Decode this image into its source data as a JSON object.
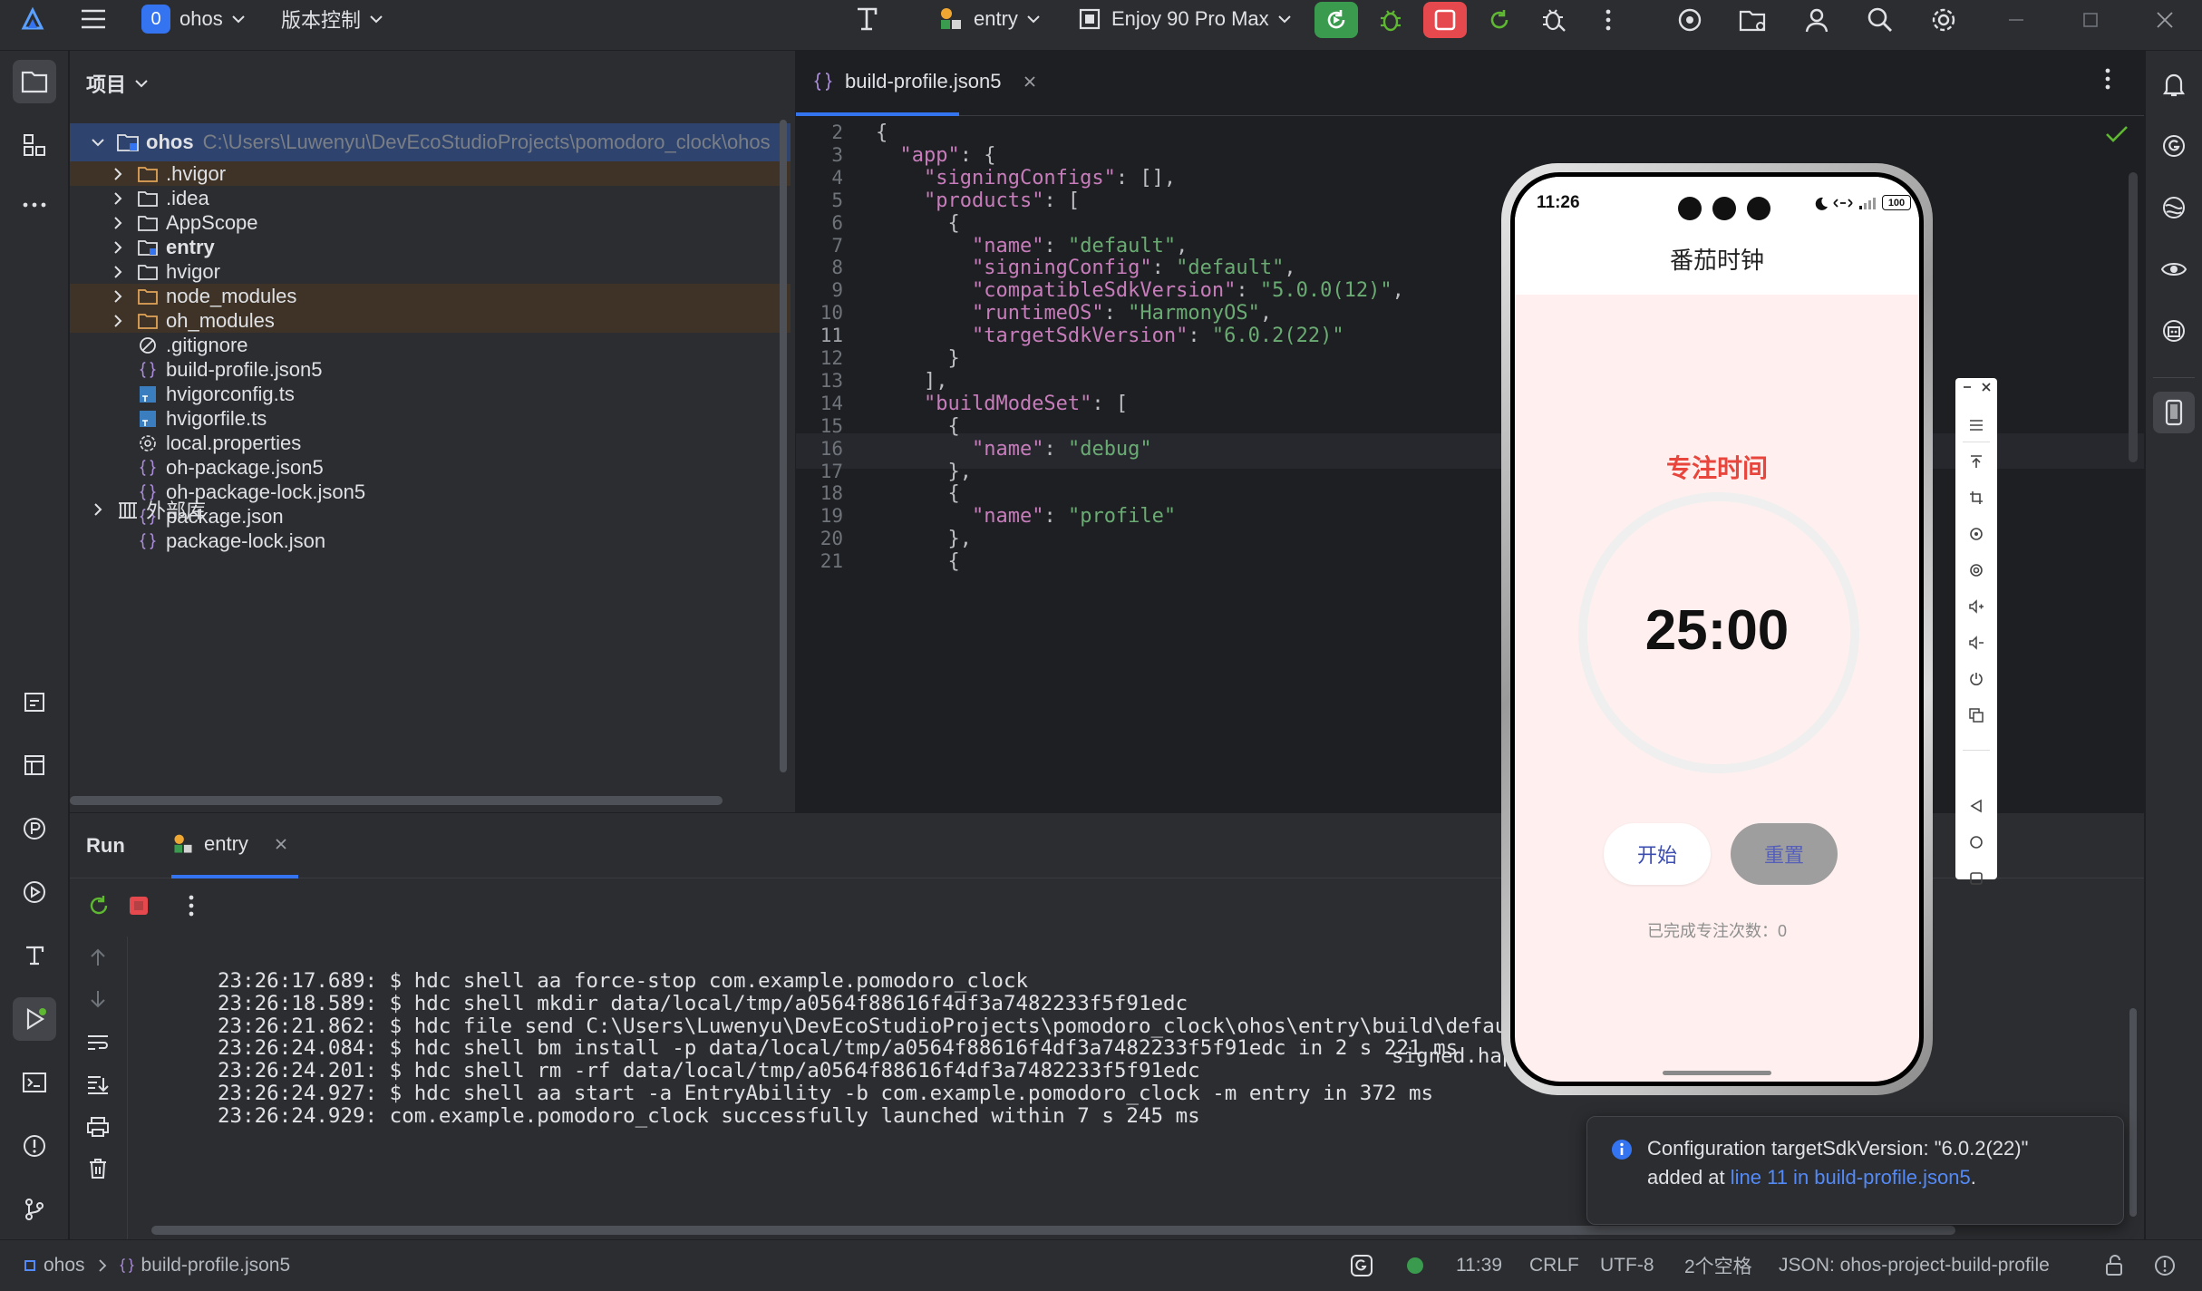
{
  "titlebar": {
    "project_badge": "0",
    "project_name": "ohos",
    "vcs_label": "版本控制",
    "run_config": "entry",
    "device": "Enjoy 90 Pro Max"
  },
  "project_panel": {
    "title": "项目",
    "root_name": "ohos",
    "root_path": "C:\\Users\\Luwenyu\\DevEcoStudioProjects\\pomodoro_clock\\ohos",
    "items": [
      {
        "label": ".hvigor",
        "icon": "folder-icon",
        "expandable": true,
        "excluded": true
      },
      {
        "label": ".idea",
        "icon": "folder-icon",
        "expandable": true,
        "excluded": false
      },
      {
        "label": "AppScope",
        "icon": "folder-icon",
        "expandable": true,
        "excluded": false
      },
      {
        "label": "entry",
        "icon": "module-folder-icon",
        "expandable": true,
        "excluded": false
      },
      {
        "label": "hvigor",
        "icon": "folder-icon",
        "expandable": true,
        "excluded": false
      },
      {
        "label": "node_modules",
        "icon": "folder-icon",
        "expandable": true,
        "excluded": true
      },
      {
        "label": "oh_modules",
        "icon": "folder-icon",
        "expandable": true,
        "excluded": true
      },
      {
        "label": ".gitignore",
        "icon": "gitignore-icon",
        "expandable": false
      },
      {
        "label": "build-profile.json5",
        "icon": "json-icon",
        "expandable": false
      },
      {
        "label": "hvigorconfig.ts",
        "icon": "ts-icon",
        "expandable": false
      },
      {
        "label": "hvigorfile.ts",
        "icon": "ts-icon",
        "expandable": false
      },
      {
        "label": "local.properties",
        "icon": "gear-file-icon",
        "expandable": false
      },
      {
        "label": "oh-package.json5",
        "icon": "json-icon",
        "expandable": false
      },
      {
        "label": "oh-package-lock.json5",
        "icon": "json-icon",
        "expandable": false
      },
      {
        "label": "package.json",
        "icon": "json-icon",
        "expandable": false
      },
      {
        "label": "package-lock.json",
        "icon": "json-icon",
        "expandable": false
      }
    ],
    "external_libs": "外部库"
  },
  "editor": {
    "tab_name": "build-profile.json5",
    "lines": [
      {
        "n": "2",
        "text": "{"
      },
      {
        "n": "3",
        "text": "  \"app\": {"
      },
      {
        "n": "4",
        "text": "    \"signingConfigs\": [],"
      },
      {
        "n": "5",
        "text": "    \"products\": ["
      },
      {
        "n": "6",
        "text": "      {"
      },
      {
        "n": "7",
        "text": "        \"name\": \"default\","
      },
      {
        "n": "8",
        "text": "        \"signingConfig\": \"default\","
      },
      {
        "n": "9",
        "text": "        \"compatibleSdkVersion\": \"5.0.0(12)\","
      },
      {
        "n": "10",
        "text": "        \"runtimeOS\": \"HarmonyOS\","
      },
      {
        "n": "11",
        "text": "        \"targetSdkVersion\": \"6.0.2(22)\""
      },
      {
        "n": "12",
        "text": "      }"
      },
      {
        "n": "13",
        "text": "    ],"
      },
      {
        "n": "14",
        "text": "    \"buildModeSet\": ["
      },
      {
        "n": "15",
        "text": "      {"
      },
      {
        "n": "16",
        "text": "        \"name\": \"debug\""
      },
      {
        "n": "17",
        "text": "      },"
      },
      {
        "n": "18",
        "text": "      {"
      },
      {
        "n": "19",
        "text": "        \"name\": \"profile\""
      },
      {
        "n": "20",
        "text": "      },"
      },
      {
        "n": "21",
        "text": "      {"
      }
    ]
  },
  "run_panel": {
    "tab_run": "Run",
    "tab_entry": "entry",
    "log": [
      "23:26:17.689: $ hdc shell aa force-stop com.example.pomodoro_clock",
      "23:26:18.589: $ hdc shell mkdir data/local/tmp/a0564f88616f4df3a7482233f5f91edc",
      "23:26:21.862: $ hdc file send C:\\Users\\Luwenyu\\DevEcoStudioProjects\\pomodoro_clock\\ohos\\entry\\build\\default",
      "23:26:24.084: $ hdc shell bm install -p data/local/tmp/a0564f88616f4df3a7482233f5f91edc in 2 s 221 ms",
      "23:26:24.201: $ hdc shell rm -rf data/local/tmp/a0564f88616f4df3a7482233f5f91edc",
      "23:26:24.927: $ hdc shell aa start -a EntryAbility -b com.example.pomodoro_clock -m entry in 372 ms",
      "23:26:24.929: com.example.pomodoro_clock successfully launched within 7 s 245 ms"
    ],
    "log_tail": "signed.hap \"data/"
  },
  "phone": {
    "time": "11:26",
    "battery": "100",
    "app_title": "番茄时钟",
    "mode_label": "专注时间",
    "timer": "25:00",
    "start_button": "开始",
    "reset_button": "重置",
    "completed_label": "已完成专注次数：0",
    "progress": 0
  },
  "notification": {
    "line1": "Configuration targetSdkVersion: \"6.0.2(22)\"",
    "line2_prefix": "added at ",
    "link": "line 11 in build-profile.json5",
    "line2_suffix": "."
  },
  "statusbar": {
    "crumb_project": "ohos",
    "crumb_file": "build-profile.json5",
    "position": "11:39",
    "line_sep": "CRLF",
    "encoding": "UTF-8",
    "indent": "2个空格",
    "schema": "JSON: ohos-project-build-profile"
  },
  "colors": {
    "accent": "#3574f0",
    "run_green": "#3a9a4e",
    "stop_red": "#e5484d",
    "phone_title_red": "#e8453c"
  }
}
